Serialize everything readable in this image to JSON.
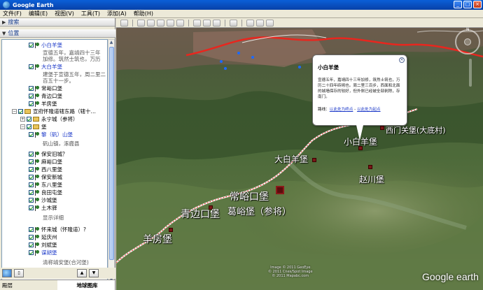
{
  "window": {
    "title": "Google Earth"
  },
  "menu": [
    "文件(F)",
    "编辑(E)",
    "视图(V)",
    "工具(T)",
    "添加(A)",
    "帮助(H)"
  ],
  "left_panel": {
    "search_label": "搜索",
    "places_label": "位置",
    "tree": [
      {
        "label": "小白羊堡",
        "desc1": "宣德五年，嘉靖四十三年",
        "desc2": "加修。筑然士筑也，万历"
      },
      {
        "label": "大白羊堡",
        "desc1": "建堡于宣德五年，周二里二",
        "desc2": "百五十一步。"
      },
      {
        "label": "常峪口堡"
      },
      {
        "label": "青边口堡"
      },
      {
        "label": "羊房堡"
      },
      {
        "label": "宣府怀隆道辖东路（辖十…"
      },
      {
        "label": "永宁城（参将）"
      },
      {
        "label": "堡"
      },
      {
        "label": "黎（矾）山堡",
        "desc1": "矾山镇，涿鹿县"
      },
      {
        "label": "保安旧城？"
      },
      {
        "label": "麻峪口堡"
      },
      {
        "label": "西八里堡"
      },
      {
        "label": "保安新城"
      },
      {
        "label": "东八里堡"
      },
      {
        "label": "良田屯堡"
      },
      {
        "label": "沙城堡"
      },
      {
        "label": "土木驿"
      },
      {
        "label": "显示详细"
      },
      {
        "label": "怀来城（怀隆道）?"
      },
      {
        "label": "延庆州"
      },
      {
        "label": "刘斌堡"
      },
      {
        "label": "谋胡堡"
      },
      {
        "label": "清称靖安堡(合河堡)"
      }
    ],
    "tabs": [
      "殿层",
      "地球图库"
    ]
  },
  "map": {
    "labels": [
      {
        "text": "小白羊堡"
      },
      {
        "text": "大白羊堡"
      },
      {
        "text": "常峪口堡"
      },
      {
        "text": "葛峪堡（参将）"
      },
      {
        "text": "青边口堡"
      },
      {
        "text": "羊房堡"
      },
      {
        "text": "赵川堡"
      },
      {
        "text": "西门关堡(大底村)"
      }
    ],
    "balloon": {
      "title": "小白羊堡",
      "body": "宣德五年，嘉靖四十三年加修，筑然士筑也，万历二十四年砖砌也。周二里三百步，西面和北面的城墙保存的较好，但外侧已经被全部剥除，存南门。",
      "route_label": "路线：",
      "route_to": "以此处为终点",
      "route_sep": " - ",
      "route_from": "以此处为起点"
    },
    "logo": "Google earth",
    "copyright": "Image © 2011 GeoEye\n© 2011 Cnes/Spot Image\n© 2011 Mapabc.com"
  }
}
